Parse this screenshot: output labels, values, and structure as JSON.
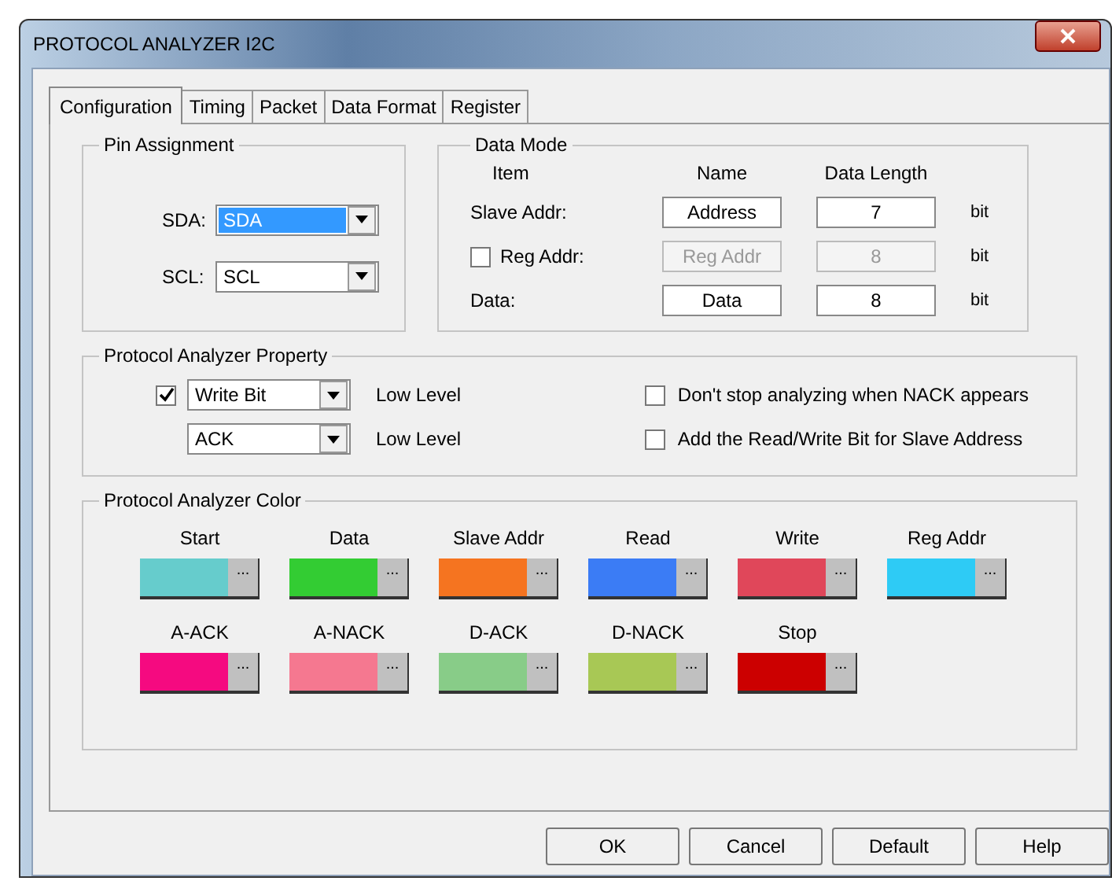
{
  "window": {
    "title": "PROTOCOL ANALYZER I2C"
  },
  "tabs": [
    {
      "label": "Configuration",
      "selected": true
    },
    {
      "label": "Timing",
      "selected": false
    },
    {
      "label": "Packet",
      "selected": false
    },
    {
      "label": "Data Format",
      "selected": false
    },
    {
      "label": "Register",
      "selected": false
    }
  ],
  "pin_assignment": {
    "title": "Pin Assignment",
    "fields": [
      {
        "label": "SDA:",
        "value": "SDA",
        "selected": true
      },
      {
        "label": "SCL:",
        "value": "SCL",
        "selected": false
      }
    ]
  },
  "data_mode": {
    "title": "Data Mode",
    "headers": [
      "Item",
      "Name",
      "Data Length"
    ],
    "rows": [
      {
        "kind": "label",
        "item": "Slave Addr:",
        "name": "Address",
        "length": "7",
        "unit": "bit",
        "disabled": false
      },
      {
        "kind": "checkbox",
        "checked": false,
        "item": "Reg Addr:",
        "name": "Reg Addr",
        "length": "8",
        "unit": "bit",
        "disabled": true
      },
      {
        "kind": "label",
        "item": "Data:",
        "name": "Data",
        "length": "8",
        "unit": "bit",
        "disabled": false
      }
    ]
  },
  "property": {
    "title": "Protocol Analyzer Property",
    "rows": [
      {
        "kind": "checkbox",
        "checked": true,
        "value": "Write Bit",
        "level": "Low Level"
      },
      {
        "kind": "plain",
        "value": "ACK",
        "level": "Low Level"
      }
    ],
    "options": [
      {
        "label": "Don't stop analyzing  when NACK appears",
        "checked": false
      },
      {
        "label": "Add the Read/Write Bit for Slave Address",
        "checked": false
      }
    ]
  },
  "colors": {
    "title": "Protocol Analyzer Color",
    "swatches": [
      {
        "label": "Start",
        "color": "#66cccc",
        "button": "..."
      },
      {
        "label": "Data",
        "color": "#33cc33",
        "button": "..."
      },
      {
        "label": "Slave Addr",
        "color": "#f57420",
        "button": "..."
      },
      {
        "label": "Read",
        "color": "#3b7cf5",
        "button": "..."
      },
      {
        "label": "Write",
        "color": "#e0475a",
        "button": "..."
      },
      {
        "label": "Reg Addr",
        "color": "#2ecbf5",
        "button": "..."
      },
      {
        "label": "A-ACK",
        "color": "#f50a80",
        "button": "..."
      },
      {
        "label": "A-NACK",
        "color": "#f57890",
        "button": "..."
      },
      {
        "label": "D-ACK",
        "color": "#88cc88",
        "button": "..."
      },
      {
        "label": "D-NACK",
        "color": "#a8c855",
        "button": "..."
      },
      {
        "label": "Stop",
        "color": "#cc0000",
        "button": "..."
      }
    ]
  },
  "buttons": [
    "OK",
    "Cancel",
    "Default",
    "Help"
  ]
}
